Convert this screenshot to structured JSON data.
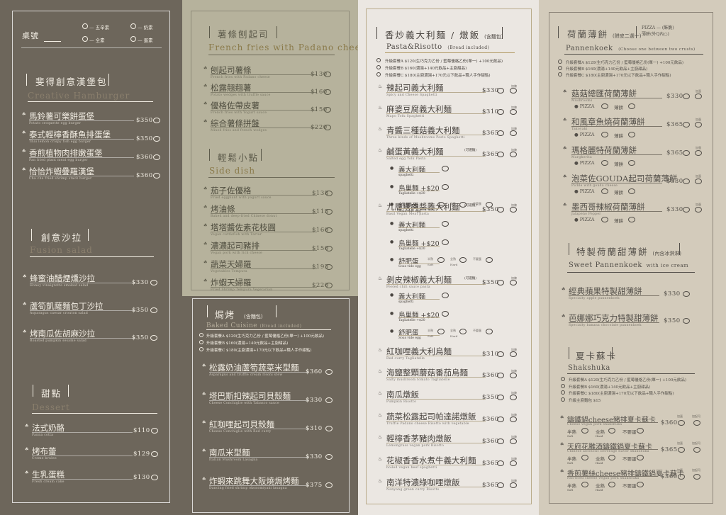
{
  "colors": {
    "panel1": "#6d665b",
    "panel2_top": "#b6b29c",
    "panel3": "#ebe7e2",
    "panel4": "#d3cbbb",
    "accent_gold": "#b29a63"
  },
  "p1": {
    "table_no": "桌號",
    "legend": [
      {
        "label": "五辛素",
        "icon": "leaf-icon"
      },
      {
        "label": "奶素",
        "icon": "milk-icon"
      },
      {
        "label": "全素",
        "icon": "sprout-icon"
      },
      {
        "label": "蛋素",
        "icon": "egg-icon"
      }
    ],
    "burger": {
      "title": "斐得創意漢堡包",
      "en": "Creative Hamburger",
      "items": [
        {
          "name": "馬鈴薯可樂餅蛋堡",
          "en": "Potato croquette egg burger",
          "price": "$350"
        },
        {
          "name": "泰式輕檸香酥魚排蛋堡",
          "en": "Thai lemon crispy fish egg burger",
          "price": "$350"
        },
        {
          "name": "香煎植物肉排嫩蛋堡",
          "en": "Pan fried plant meat egg burger",
          "price": "$360"
        },
        {
          "name": "恰恰炸蝦疊羅漢堡",
          "en": "Cha cha fried shrimp stack burger",
          "price": "$360"
        }
      ]
    },
    "salad": {
      "title": "創意沙拉",
      "en": "Fusion salad",
      "items": [
        {
          "name": "蜂蜜油醋煙燻沙拉",
          "en": "Honey vinaigrette smoked salad",
          "price": "$330"
        },
        {
          "name": "蘆筍凱薩麵包丁沙拉",
          "en": "Asparagus caesar crouton salad",
          "price": "$350"
        },
        {
          "name": "烤南瓜佐胡麻沙拉",
          "en": "Roasted pumpkin sesame salad",
          "price": "$350"
        }
      ]
    },
    "dessert": {
      "title": "甜點",
      "en": "Dessert",
      "items": [
        {
          "name": "法式奶酪",
          "en": "Panna cotta",
          "price": "$110"
        },
        {
          "name": "烤布蕾",
          "en": "Creme brulee",
          "price": "$129"
        },
        {
          "name": "生乳蛋糕",
          "en": "Fresh cream cake",
          "price": "$130"
        }
      ]
    }
  },
  "p2": {
    "fries": {
      "title": "薯條刨起司",
      "en": "French fries with Padano cheese",
      "items": [
        {
          "name": "刨起司薯條",
          "en": "French fries with Padano cheese",
          "price": "$130"
        },
        {
          "name": "松露翹翹薯",
          "en": "Potato wedges with truffle sauce",
          "price": "$160"
        },
        {
          "name": "優格佐帶皮薯",
          "en": "French fries with Yogurt sauce",
          "price": "$150"
        },
        {
          "name": "綜合薯條拼盤",
          "en": "Mixed fries and french wedges",
          "price": "$220"
        }
      ]
    },
    "side": {
      "title": "輕鬆小點",
      "en": "Side dish",
      "items": [
        {
          "name": "茄子佐優格",
          "en": "Fried eggplant with yogurt sauce",
          "price": "$138"
        },
        {
          "name": "烤油條",
          "en": "Baked and deep-fried Chinese donut",
          "price": "$115"
        },
        {
          "name": "塔塔醬佐素花枝圓",
          "en": "Vegan cuttlefish with Tartar",
          "price": "$160"
        },
        {
          "name": "濃濃起司豬排",
          "en": "Vegan pork with rich cheese",
          "price": "$150"
        },
        {
          "name": "蔬菜天婦羅",
          "en": "Vegetables Tempura",
          "price": "$195"
        },
        {
          "name": "炸蝦天婦羅",
          "en": "Fried Shrimp Tempura Vegetarian",
          "price": "$220"
        }
      ]
    },
    "baked": {
      "title": "焗烤",
      "note": "(含麵包)",
      "en": "Baked Cuisine",
      "en_note": "(Bread included)",
      "sets": [
        "升級套餐A $120(生巧克力乙份 / 藍莓優格乙份(單一) +100元飲品)",
        "升級套餐B $160(濃湯+140元飲品+主廚甜品)",
        "升級套餐C $180(主廚濃湯+170元以下飲品+職人手作甜點)"
      ],
      "items": [
        {
          "name": "松露奶油蘆筍蔬菜米型麵",
          "en": "Asparagus and truffle cream risoni stew",
          "price": "$360"
        },
        {
          "name": "塔巴斯扣辣起司貝殼麵",
          "en": "Cheese Conchiglie with Tabasco sauce",
          "price": "$330"
        },
        {
          "name": "紅咖哩起司貝殼麵",
          "en": "Cheese Conchiglie with Red curry",
          "price": "$310"
        },
        {
          "name": "南瓜米型麵",
          "en": "Italian Mushroom Lasagna",
          "price": "$330"
        },
        {
          "name": "炸蝦來跳舞大阪燒焗烤麵",
          "en": "Dancing fried shrimp okonomiyaki lasagna",
          "price": "$375"
        }
      ]
    }
  },
  "p3": {
    "title": "香炒義大利麵 / 燉飯",
    "note": "(含麵包)",
    "en": "Pasta&Risotto",
    "en_note": "(Bread included)",
    "sets": [
      "升級套餐A $120(生巧克力乙份 / 藍莓優格乙份(單一) +100元飲品)",
      "升級套餐B $160(濃湯+140元飲品+主廚甜品)",
      "升級套餐C $180(主廚濃湯+170元以下飲品+職人手作甜點)"
    ],
    "spicy": "加辣",
    "items": [
      {
        "name": "辣起司義大利麵",
        "en": "Spicy and Cheese Spaghetti",
        "price": "$330"
      },
      {
        "name": "麻婆豆腐義大利麵",
        "en": "Mapo Tofu Spaghetti",
        "price": "$310"
      },
      {
        "name": "青醬三種菇義大利麵",
        "en": "Three kinds of Mushrooms Pesto Spaghetti",
        "price": "$365"
      },
      {
        "name": "鹹蛋黃義大利麵",
        "note": "(可選麵)",
        "en": "Salted egg Yolk Pasta",
        "price": "$365"
      },
      {
        "name": "九層塔肉醬義大利麵",
        "note": "(可選麵)",
        "en": "Basil Vegan Meat pasta",
        "price": "$350"
      },
      {
        "name": "剝皮辣椒義大利麵",
        "note": "(可選麵)",
        "en": "Peeled chili sauce pasta",
        "price": "$350"
      },
      {
        "name": "紅咖哩義大利烏麵",
        "en": "Red curry Tagliatelle",
        "price": "$310"
      },
      {
        "name": "海鹽整顆蘑菇番茄烏麵",
        "en": "Salty mushroom tomato Tagliatelle",
        "price": "$360"
      },
      {
        "name": "南瓜燉飯",
        "en": "Pumpkin Risotto",
        "price": "$350"
      },
      {
        "name": "蔬菜松露起司帕達諾燉飯",
        "en": "Truffle Padano cheese Risotto with vegetable",
        "price": "$360"
      },
      {
        "name": "輕檸香茅豬肉燉飯",
        "en": "Lemongrass vegan pork Risotto",
        "price": "$360"
      },
      {
        "name": "花椒香香水煮牛義大利麵",
        "en": "boiled vegan beef spaghetti",
        "price": "$365"
      },
      {
        "name": "南洋特濃綠咖哩燉飯",
        "en": "Nanyang green curry Risotto",
        "price": "$365"
      }
    ],
    "opt_spaghetti": "義大利麵",
    "opt_spaghetti_en": "spaghetti",
    "opt_tag": "烏巢麵 +$20",
    "opt_tag_en": "Tagliatelle +$20",
    "opt_egg": "舒肥蛋",
    "opt_egg_en": "Sous vide egg",
    "opt_soft": "半熟",
    "opt_soft_en": "Soft",
    "opt_hard": "全熟",
    "opt_hard_en": "Hard",
    "opt_no": "不要蛋"
  },
  "p4": {
    "title": "荷蘭薄餅",
    "note": "(餅皮二選一)",
    "pizza_opt": "PIZZA — (酥脆)",
    "pan_opt": "薄餅(外Q內○)",
    "en": "Pannenkoek",
    "en_note": "(Choose one between two crusts)",
    "sets": [
      "升級套餐A $120(生巧克力乙份 / 藍莓優格乙份(單一) +100元飲品)",
      "升級套餐B $160(濃湯+140元飲品+主廚甜品)",
      "升級套餐C $180(主廚濃湯+170元以下飲品+職人手作甜點)"
    ],
    "add": "加蛋",
    "nopizza": "PIZZA",
    "pan": "薄餅",
    "items": [
      {
        "name": "菇菇總匯荷蘭薄餅",
        "en": "Mushrooms",
        "price": "$330"
      },
      {
        "name": "和風章魚燒荷蘭薄餅",
        "en": "Takoyaki",
        "price": "$365"
      },
      {
        "name": "瑪格麗特荷蘭薄餅",
        "en": "Margherita",
        "price": "$365"
      },
      {
        "name": "泡菜佐GOUDA起司荷蘭薄餅",
        "en": "Pickle with gouda cheese",
        "price": "$330"
      },
      {
        "name": "墨西哥辣椒荷蘭薄餅",
        "en": "Jalapeno Pepper",
        "price": "$330"
      }
    ],
    "sweet": {
      "title": "特製荷蘭甜薄餅",
      "note": "(內含冰淇淋)",
      "en": "Sweet Pannenkoek",
      "en_note": "with ice cream",
      "items": [
        {
          "name": "經典蘋果特製甜薄餅",
          "en": "Specialty apple pannenkoek",
          "price": "$330"
        },
        {
          "name": "芭娜娜巧克力特製甜薄餅",
          "en": "Specialty banana chocolate pannenkoek",
          "price": "$350"
        }
      ]
    },
    "shak": {
      "title": "夏卡蘇卡",
      "en": "Shakshuka",
      "sets": [
        "升級套餐A $120(生巧克力乙份 / 藍莓優格乙份(單一) +100元飲品)",
        "升級套餐B $160(濃湯+140元飲品+主廚甜品)",
        "升級套餐C $180(主廚濃湯+170元以下飲品+職人手作甜點)",
        "升級主廚麵包 $15"
      ],
      "egg": "加蛋",
      "cheese": "加起司",
      "half": "半熟",
      "half_en": "Soft",
      "full": "全熟",
      "full_en": "Hard",
      "none": "不要蛋",
      "items": [
        {
          "name": "鑄鐵鍋cheese豬排夏卡蘇卡",
          "en": "Cheese vegan pork shakshuka",
          "price": "$360"
        },
        {
          "name": "天府花雕酒鑄鐵鍋夏卡蘇卡",
          "en": "Chinese alcoholic beverage flavor shakshuka",
          "price": "$365"
        },
        {
          "name": "香煎薯絲cheese豬排鑄鐵鍋夏卡蘇卡",
          "en": "Pan-fried cheese vegan pork shakshuka",
          "price": "$360"
        }
      ]
    }
  }
}
